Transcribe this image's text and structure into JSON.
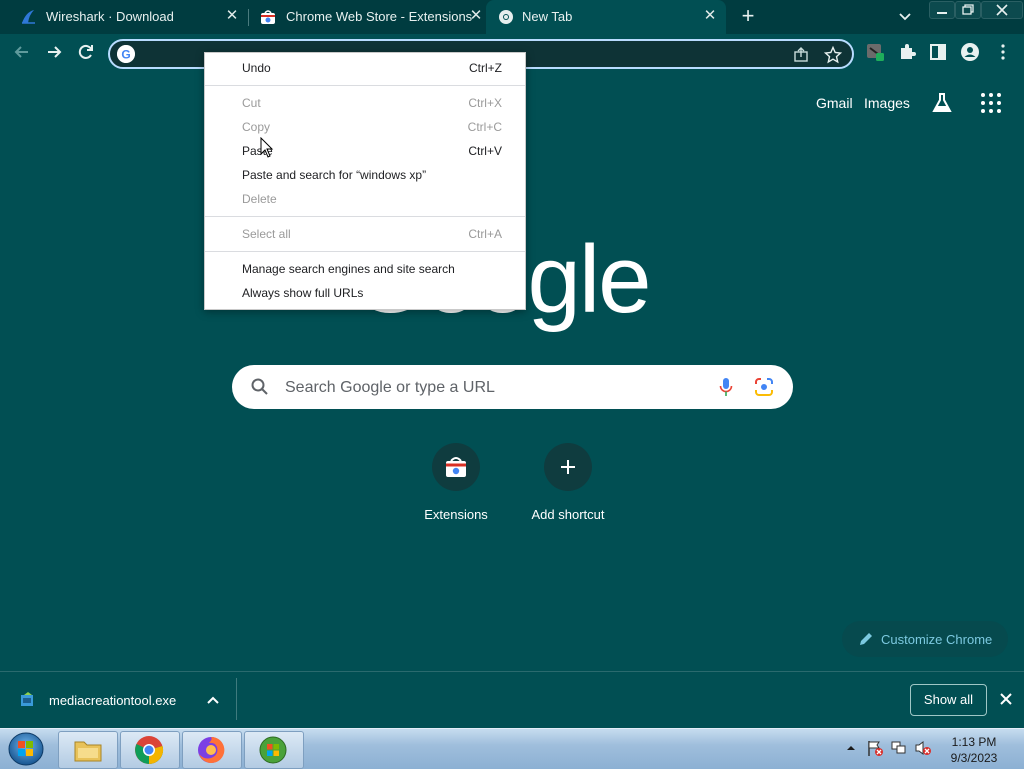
{
  "tabs": [
    {
      "title": "Wireshark · Download",
      "active": false
    },
    {
      "title": "Chrome Web Store - Extensions",
      "active": false
    },
    {
      "title": "New Tab",
      "active": true
    }
  ],
  "omnibox": {
    "value": "",
    "placeholder": ""
  },
  "header_links": {
    "gmail": "Gmail",
    "images": "Images"
  },
  "logo_text": "Google",
  "search": {
    "placeholder": "Search Google or type a URL"
  },
  "shortcuts": [
    {
      "label": "Extensions",
      "icon": "chrome-web-store-icon"
    },
    {
      "label": "Add shortcut",
      "icon": "plus-icon"
    }
  ],
  "customize": {
    "label": "Customize Chrome"
  },
  "context_menu": {
    "items": [
      {
        "label": "Undo",
        "shortcut": "Ctrl+Z",
        "enabled": true
      },
      {
        "label": "Cut",
        "shortcut": "Ctrl+X",
        "enabled": false
      },
      {
        "label": "Copy",
        "shortcut": "Ctrl+C",
        "enabled": false
      },
      {
        "label": "Paste",
        "shortcut": "Ctrl+V",
        "enabled": true
      },
      {
        "label": "Paste and search for “windows xp”",
        "shortcut": "",
        "enabled": true
      },
      {
        "label": "Delete",
        "shortcut": "",
        "enabled": false
      },
      {
        "label": "Select all",
        "shortcut": "Ctrl+A",
        "enabled": false
      },
      {
        "label": "Manage search engines and site search",
        "shortcut": "",
        "enabled": true
      },
      {
        "label": "Always show full URLs",
        "shortcut": "",
        "enabled": true
      }
    ]
  },
  "downloads": {
    "file_name": "mediacreationtool.exe",
    "show_all_label": "Show all"
  },
  "taskbar": {
    "time": "1:13 PM",
    "date": "9/3/2023",
    "apps": [
      "file-explorer-icon",
      "chrome-icon",
      "firefox-icon",
      "windows-update-icon"
    ]
  },
  "colors": {
    "page_bg": "#014f53",
    "tabstrip_bg": "#003c40",
    "accent_link": "#7cc9e0",
    "omnibox_focus": "#b8dcff"
  }
}
